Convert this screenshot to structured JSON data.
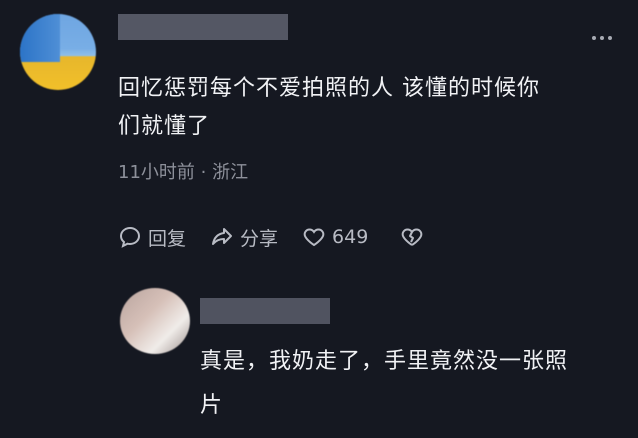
{
  "comment": {
    "text_line1": "回忆惩罚每个不爱拍照的人  该懂的时候你",
    "text_line2": "们就懂了",
    "meta": "11小时前 · 浙江",
    "actions": {
      "reply_label": "回复",
      "share_label": "分享",
      "like_count": "649"
    }
  },
  "reply": {
    "text_line1": "真是，我奶走了，手里竟然没一张照",
    "text_line2": "片"
  }
}
